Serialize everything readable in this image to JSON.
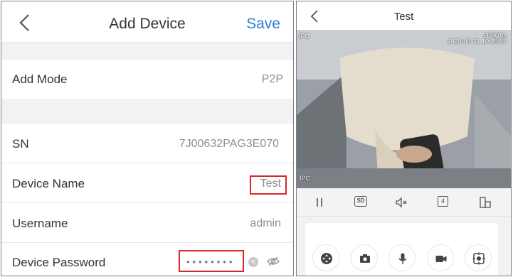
{
  "add_device": {
    "title": "Add Device",
    "save_label": "Save",
    "rows": {
      "add_mode": {
        "label": "Add Mode",
        "value": "P2P"
      },
      "sn": {
        "label": "SN",
        "value": "7J00632PAG3E070"
      },
      "device_name": {
        "label": "Device Name",
        "value": "Test"
      },
      "username": {
        "label": "Username",
        "value": "admin"
      },
      "device_password": {
        "label": "Device Password",
        "value": "••••••••"
      }
    }
  },
  "live_view": {
    "title": "Test",
    "osd_top_left": "IPC",
    "osd_bitrate": "117KB/s",
    "osd_datetime": "2023-08-31 10:28:57",
    "osd_bottom_left": "IPC",
    "controls": {
      "pause_icon": "pause-icon",
      "quality_label": "SD",
      "mute_icon": "speaker-mute-icon",
      "split_label": "4",
      "layout_icon": "layout-icon"
    },
    "actions": [
      "ptz-icon",
      "snapshot-icon",
      "microphone-icon",
      "record-icon",
      "preset-icon"
    ]
  },
  "colors": {
    "accent": "#2a7fd4",
    "highlight_box": "#d9262c"
  }
}
